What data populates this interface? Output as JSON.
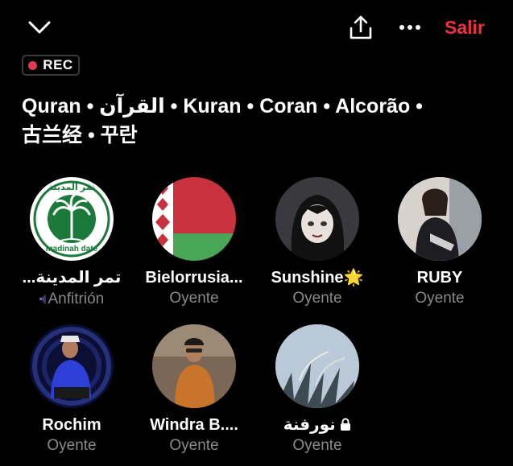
{
  "header": {
    "exit_label": "Salir",
    "rec_label": "REC"
  },
  "title": {
    "line1": "Quran • القرآن • Kuran • Coran • Alcorão •",
    "line2": "古兰经 • 꾸란"
  },
  "participants": [
    {
      "name": "...تمر المدينة",
      "role": "Anfitrión",
      "avatar_text_top": "تمر المدينة",
      "avatar_text_bottom": "madinah date"
    },
    {
      "name": "Bielorrusia...",
      "role": "Oyente"
    },
    {
      "name": "Sunshine",
      "role": "Oyente",
      "badge": "🌟"
    },
    {
      "name": "RUBY",
      "role": "Oyente"
    },
    {
      "name": "Rochim",
      "role": "Oyente"
    },
    {
      "name": "Windra B....",
      "role": "Oyente"
    },
    {
      "name": "نورفنة",
      "role": "Oyente",
      "icon": "lock-icon"
    }
  ],
  "colors": {
    "accent_red": "#f0323c",
    "host_purple": "#8b6cf3",
    "muted": "#8a8a8a"
  }
}
